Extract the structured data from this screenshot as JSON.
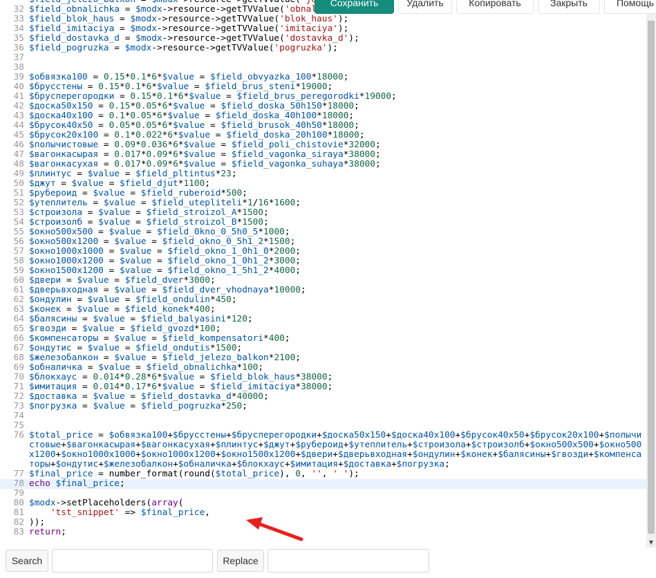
{
  "toolbar": {
    "save_label": "Сохранить",
    "delete_label": "Удалить",
    "copy_label": "Копировать",
    "close_label": "Закрыть",
    "help_label": "Помощь"
  },
  "search": {
    "search_label": "Search",
    "replace_label": "Replace",
    "search_value": "",
    "replace_value": ""
  },
  "colors": {
    "primary_button": "#148d7d",
    "variable": "#0055aa",
    "number": "#116644",
    "string": "#aa1111",
    "keyword": "#770088",
    "annotation_arrow": "#e8201c"
  },
  "editor": {
    "active_line": 78,
    "lines": [
      {
        "num": "",
        "text": "$field_jelezo_balkon = $modx->resource->getTVValue('jelezo_balkon');"
      },
      {
        "num": "32",
        "text": "$field_obnalichka = $modx->resource->getTVValue('obnalichka');"
      },
      {
        "num": "33",
        "text": "$field_blok_haus = $modx->resource->getTVValue('blok_haus');"
      },
      {
        "num": "34",
        "text": "$field_imitaciya = $modx->resource->getTVValue('imitaciya');"
      },
      {
        "num": "35",
        "text": "$field_dostavka_d = $modx->resource->getTVValue('dostavka_d');"
      },
      {
        "num": "36",
        "text": "$field_pogruzka = $modx->resource->getTVValue('pogruzka');"
      },
      {
        "num": "37",
        "text": ""
      },
      {
        "num": "38",
        "text": ""
      },
      {
        "num": "39",
        "text": "$обвязка100 = 0.15*0.1*6*$value = $field_obvyazka_100*18000;"
      },
      {
        "num": "40",
        "text": "$брусстены = 0.15*0.1*6*$value = $field_brus_steni*19000;"
      },
      {
        "num": "41",
        "text": "$брусперегородки = 0.15*0.1*6*$value = $field_brus_peregorodki*19000;"
      },
      {
        "num": "42",
        "text": "$доска50х150 = 0.15*0.05*6*$value = $field_doska_50h150*18000;"
      },
      {
        "num": "43",
        "text": "$доска40х100 = 0.1*0.05*6*$value = $field_doska_40h100*18000;"
      },
      {
        "num": "44",
        "text": "$брусок40х50 = 0.05*0.05*6*$value = $field_brusok_40h50*18000;"
      },
      {
        "num": "45",
        "text": "$брусок20х100 = 0.1*0.022*6*$value = $field_doska_20h100*18000;"
      },
      {
        "num": "46",
        "text": "$полычистовые = 0.09*0.036*6*$value = $field_poli_chistovie*32000;"
      },
      {
        "num": "47",
        "text": "$вагонкасырая = 0.017*0.09*6*$value = $field_vagonka_siraya*38000;"
      },
      {
        "num": "48",
        "text": "$вагонкасухая = 0.017*0.09*6*$value = $field_vagonka_suhaya*38000;"
      },
      {
        "num": "49",
        "text": "$плинтус = $value = $field_pltintus*23;"
      },
      {
        "num": "50",
        "text": "$джут = $value = $field_djut*1100;"
      },
      {
        "num": "51",
        "text": "$рубероид = $value = $field_ruberoid*500;"
      },
      {
        "num": "52",
        "text": "$утеплитель = $value = $field_utepliteli*1/16*1600;"
      },
      {
        "num": "53",
        "text": "$строизола = $value = $field_stroizol_A*1500;"
      },
      {
        "num": "54",
        "text": "$строизолб = $value = $field_stroizol_B*1500;"
      },
      {
        "num": "55",
        "text": "$окно500х500 = $value = $field_0kno_0_5h0_5*1000;"
      },
      {
        "num": "56",
        "text": "$окно500х1200 = $value = $field_okno_0_5h1_2*1500;"
      },
      {
        "num": "57",
        "text": "$окно1000х1000 = $value = $field_okno_1_0h1_0*2000;"
      },
      {
        "num": "58",
        "text": "$окно1000х1200 = $value = $field_okno_1_0h1_2*3000;"
      },
      {
        "num": "59",
        "text": "$окно1500х1200 = $value = $field_okno_1_5h1_2*4000;"
      },
      {
        "num": "60",
        "text": "$двери = $value = $field_dver*3000;"
      },
      {
        "num": "61",
        "text": "$дверьвходная = $value = $field_dver_vhodnaya*10000;"
      },
      {
        "num": "62",
        "text": "$ондулин = $value = $field_ondulin*450;"
      },
      {
        "num": "63",
        "text": "$конек = $value = $field_konek*400;"
      },
      {
        "num": "64",
        "text": "$балясины = $value = $field_balyasini*120;"
      },
      {
        "num": "65",
        "text": "$гвозди = $value = $field_gvozd*100;"
      },
      {
        "num": "66",
        "text": "$компенсаторы = $value = $field_kompensatori*400;"
      },
      {
        "num": "67",
        "text": "$ондутис = $value = $field_ondutis*1500;"
      },
      {
        "num": "68",
        "text": "$железобалкон = $value = $field_jelezo_balkon*2100;"
      },
      {
        "num": "69",
        "text": "$обналичка = $value = $field_obnalichka*100;"
      },
      {
        "num": "70",
        "text": "$блокхаус = 0.014*0.28*6*$value = $field_blok_haus*38000;"
      },
      {
        "num": "71",
        "text": "$имитация = 0.014*0.17*6*$value = $field_imitaciya*38000;"
      },
      {
        "num": "72",
        "text": "$доставка = $value = $field_dostavka_d*40000;"
      },
      {
        "num": "73",
        "text": "$погрузка = $value = $field_pogruzka*250;"
      },
      {
        "num": "74",
        "text": ""
      },
      {
        "num": "75",
        "text": ""
      },
      {
        "num": "76",
        "text": "$total_price = $обвязка100+$брусстены+$брусперегородки+$доска50х150+$доска40х100+$брусок40х50+$брусок20х100+$полычистовые+$вагонкасырая+$вагонкасухая+$плинтус+$джут+$рубероид+$утеплитель+$строизола+$строизолб+$окно500х500+$окно500х1200+$окно1000х1000+$окно1000х1200+$окно1500х1200+$двери+$дверьвходная+$ондулин+$конек+$балясины+$гвозди+$компенсаторы+$ондутис+$железобалкон+$обналичка+$блокхаус+$имитация+$доставка+$погрузка;"
      },
      {
        "num": "77",
        "text": "$final_price = number_format(round($total_price), 0, '', ' ');"
      },
      {
        "num": "78",
        "text": "echo $final_price;"
      },
      {
        "num": "79",
        "text": ""
      },
      {
        "num": "80",
        "text": "$modx->setPlaceholders(array("
      },
      {
        "num": "81",
        "text": "    'tst_snippet' => $final_price,"
      },
      {
        "num": "82",
        "text": "));"
      },
      {
        "num": "83",
        "text": "return;"
      }
    ]
  }
}
